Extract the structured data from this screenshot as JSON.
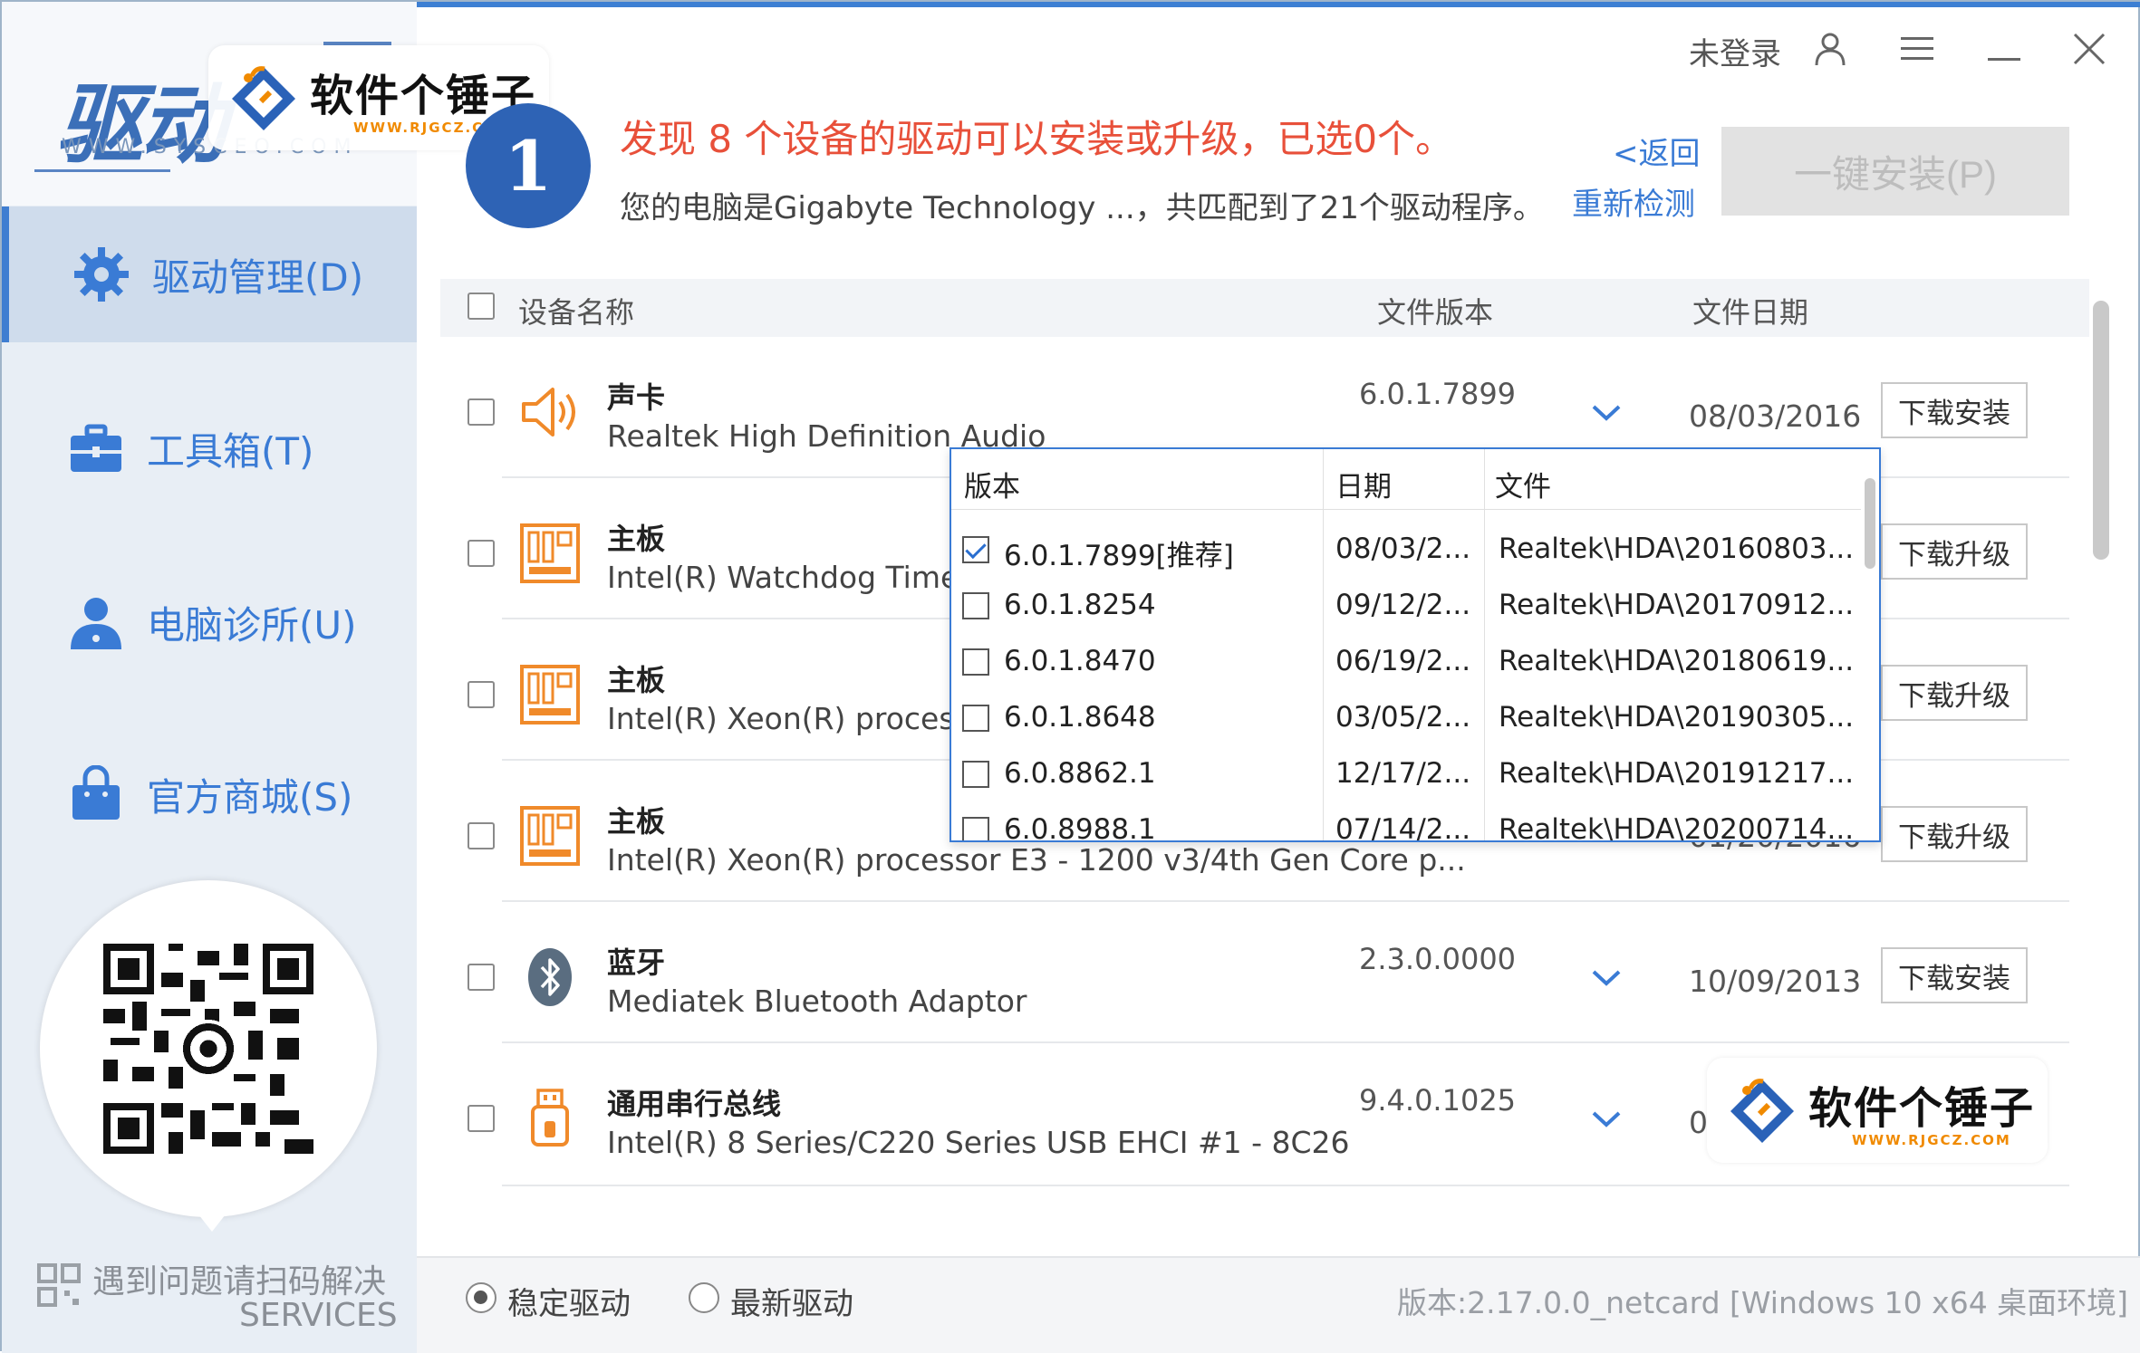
{
  "app": {
    "logo_text": "驱动",
    "logo_sub": "WWW.SYSCEO.COM",
    "login_text": "未登录"
  },
  "watermark": {
    "title": "软件个锤子",
    "url": "WWW.RJGCZ.COM"
  },
  "sidebar": {
    "items": [
      {
        "label": "驱动管理(D)",
        "icon": "gear-icon"
      },
      {
        "label": "工具箱(T)",
        "icon": "toolbox-icon"
      },
      {
        "label": "电脑诊所(U)",
        "icon": "user-icon"
      },
      {
        "label": "官方商城(S)",
        "icon": "shop-bag-icon"
      }
    ],
    "help_text": "遇到问题请扫码解决",
    "help_sub": "SERVICES"
  },
  "header": {
    "badge": "1",
    "headline": "发现 8 个设备的驱动可以安装或升级，已选0个。",
    "subline": "您的电脑是Gigabyte Technology ...，共匹配到了21个驱动程序。",
    "back": "<返回",
    "recheck": "重新检测",
    "install_all": "一键安装(P)"
  },
  "table": {
    "headers": {
      "name": "设备名称",
      "version": "文件版本",
      "date": "文件日期"
    },
    "rows": [
      {
        "category": "声卡",
        "name": "Realtek High Definition Audio",
        "version": "6.0.1.7899",
        "date": "08/03/2016",
        "action": "下载安装",
        "icon": "speaker-icon"
      },
      {
        "category": "主板",
        "name": "Intel(R) Watchdog Timer Dri...",
        "version": "",
        "date": "",
        "action": "下载升级",
        "icon": "motherboard-icon"
      },
      {
        "category": "主板",
        "name": "Intel(R) Xeon(R) processor E3 - 1200 v3/4th Gen Core p...",
        "version": "",
        "date": "",
        "action": "下载升级",
        "icon": "motherboard-icon"
      },
      {
        "category": "主板",
        "name": "Intel(R) Xeon(R) processor E3 - 1200 v3/4th Gen Core p...",
        "version": "",
        "date": "01/20/2016",
        "action": "下载升级",
        "icon": "motherboard-icon"
      },
      {
        "category": "蓝牙",
        "name": "Mediatek Bluetooth Adaptor",
        "version": "2.3.0.0000",
        "date": "10/09/2013",
        "action": "下载安装",
        "icon": "bluetooth-icon"
      },
      {
        "category": "通用串行总线",
        "name": "Intel(R) 8 Series/C220 Series USB EHCI #1 - 8C26",
        "version": "9.4.0.1025",
        "date": "0",
        "action": "",
        "icon": "usb-icon"
      }
    ]
  },
  "dropdown": {
    "headers": {
      "version": "版本",
      "date": "日期",
      "file": "文件"
    },
    "rows": [
      {
        "version": "6.0.1.7899[推荐]",
        "date": "08/03/2...",
        "file": "Realtek\\HDA\\20160803...",
        "checked": true
      },
      {
        "version": "6.0.1.8254",
        "date": "09/12/2...",
        "file": "Realtek\\HDA\\20170912...",
        "checked": false
      },
      {
        "version": "6.0.1.8470",
        "date": "06/19/2...",
        "file": "Realtek\\HDA\\20180619...",
        "checked": false
      },
      {
        "version": "6.0.1.8648",
        "date": "03/05/2...",
        "file": "Realtek\\HDA\\20190305...",
        "checked": false
      },
      {
        "version": "6.0.8862.1",
        "date": "12/17/2...",
        "file": "Realtek\\HDA\\20191217...",
        "checked": false
      },
      {
        "version": "6.0.8988.1",
        "date": "07/14/2...",
        "file": "Realtek\\HDA\\20200714...",
        "checked": false
      }
    ]
  },
  "footer": {
    "radio_stable": "稳定驱动",
    "radio_latest": "最新驱动",
    "version_text": "版本:2.17.0.0_netcard [Windows 10 x64 桌面环境]"
  },
  "colors": {
    "accent": "#3a7bd5",
    "headline": "#e8503a",
    "badge": "#2e63b5",
    "icon_orange": "#f08a2a"
  }
}
